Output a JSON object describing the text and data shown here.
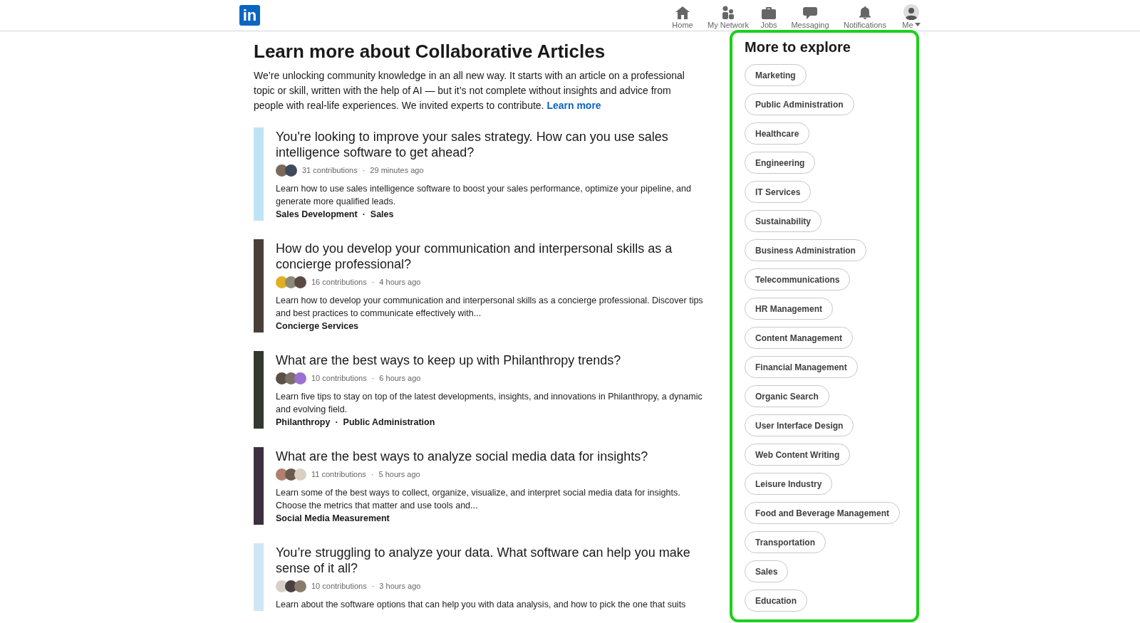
{
  "nav": {
    "logo": "in",
    "items": [
      {
        "label": "Home",
        "kind": "home"
      },
      {
        "label": "My Network",
        "kind": "network"
      },
      {
        "label": "Jobs",
        "kind": "jobs"
      },
      {
        "label": "Messaging",
        "kind": "messaging"
      },
      {
        "label": "Notifications",
        "kind": "notifications"
      },
      {
        "label": "Me",
        "kind": "me"
      }
    ]
  },
  "main": {
    "title": "Learn more about Collaborative Articles",
    "intro": "We’re unlocking community knowledge in an all new way. It starts with an article on a professional topic or skill, written with the help of AI — but it’s not complete without insights and advice from people with real-life experiences. We invited experts to contribute.",
    "intro_link": "Learn more"
  },
  "articles": [
    {
      "title": "You're looking to improve your sales strategy. How can you use sales intelligence software to get ahead?",
      "avatars": [
        {
          "color": "#7a6a5c"
        },
        {
          "color": "#3f4a5a"
        }
      ],
      "contributions": "31 contributions",
      "separator": "·",
      "time": "29 minutes ago",
      "description": "Learn how to use sales intelligence software to boost your sales performance, optimize your pipeline, and generate more qualified leads.",
      "topics": [
        {
          "kind": "topic",
          "text": "Sales Development"
        },
        {
          "kind": "separator",
          "text": "·"
        },
        {
          "kind": "topic",
          "text": "Sales"
        }
      ]
    },
    {
      "title": "How do you develop your communication and interpersonal skills as a concierge professional?",
      "avatars": [
        {
          "color": "#e0b020"
        },
        {
          "color": "#8a8a7a"
        },
        {
          "color": "#5a4a44"
        }
      ],
      "contributions": "16 contributions",
      "separator": "·",
      "time": "4 hours ago",
      "description": "Learn how to develop your communication and interpersonal skills as a concierge professional. Discover tips and best practices to communicate effectively with...",
      "topics": [
        {
          "kind": "topic",
          "text": "Concierge Services"
        }
      ]
    },
    {
      "title": "What are the best ways to keep up with Philanthropy trends?",
      "avatars": [
        {
          "color": "#5a5048"
        },
        {
          "color": "#7a7068"
        },
        {
          "color": "#9a70d0"
        }
      ],
      "contributions": "10 contributions",
      "separator": "·",
      "time": "6 hours ago",
      "description": "Learn five tips to stay on top of the latest developments, insights, and innovations in Philanthropy, a dynamic and evolving field.",
      "topics": [
        {
          "kind": "topic",
          "text": "Philanthropy"
        },
        {
          "kind": "separator",
          "text": "·"
        },
        {
          "kind": "topic",
          "text": "Public Administration"
        }
      ]
    },
    {
      "title": "What are the best ways to analyze social media data for insights?",
      "avatars": [
        {
          "color": "#b08070"
        },
        {
          "color": "#6a5a50"
        },
        {
          "color": "#d8d0c0"
        }
      ],
      "contributions": "11 contributions",
      "separator": "·",
      "time": "5 hours ago",
      "description": "Learn some of the best ways to collect, organize, visualize, and interpret social media data for insights. Choose the metrics that matter and use tools and...",
      "topics": [
        {
          "kind": "topic",
          "text": "Social Media Measurement"
        }
      ]
    },
    {
      "title": "You’re struggling to analyze your data. What software can help you make sense of it all?",
      "avatars": [
        {
          "color": "#d8d0c8"
        },
        {
          "color": "#4a4040"
        },
        {
          "color": "#8a7a6a"
        }
      ],
      "contributions": "10 contributions",
      "separator": "·",
      "time": "3 hours ago",
      "description": "Learn about the software options that can help you with data analysis, and how to pick the one that suits"
    }
  ],
  "sidebar": {
    "title": "More to explore",
    "tags": [
      "Marketing",
      "Public Administration",
      "Healthcare",
      "Engineering",
      "IT Services",
      "Sustainability",
      "Business Administration",
      "Telecommunications",
      "HR Management",
      "Content Management",
      "Financial Management",
      "Organic Search",
      "User Interface Design",
      "Web Content Writing",
      "Leisure Industry",
      "Food and Beverage Management",
      "Transportation",
      "Sales",
      "Education"
    ]
  }
}
